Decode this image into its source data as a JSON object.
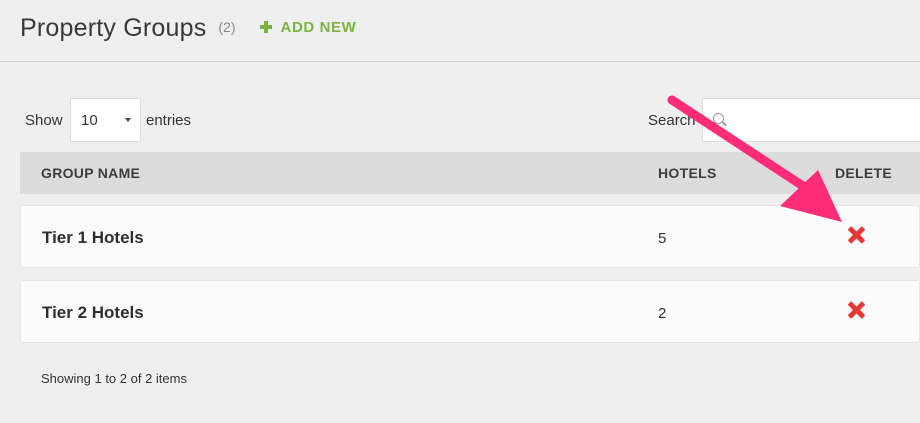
{
  "header": {
    "title": "Property Groups",
    "count": "(2)",
    "add_new_label": "ADD NEW",
    "add_icon": "plus-icon"
  },
  "controls": {
    "show_label": "Show",
    "page_size": "10",
    "entries_label": "entries",
    "search_label": "Search",
    "search_value": ""
  },
  "table": {
    "columns": [
      "GROUP NAME",
      "HOTELS",
      "DELETE"
    ],
    "rows": [
      {
        "name": "Tier 1 Hotels",
        "hotels": "5",
        "delete_icon": "close-icon"
      },
      {
        "name": "Tier 2 Hotels",
        "hotels": "2",
        "delete_icon": "close-icon"
      }
    ]
  },
  "footer": {
    "info": "Showing 1 to 2 of 2 items"
  },
  "colors": {
    "accent_green": "#7cb342",
    "delete_red": "#e53935",
    "annotation_pink": "#ff2d78"
  }
}
